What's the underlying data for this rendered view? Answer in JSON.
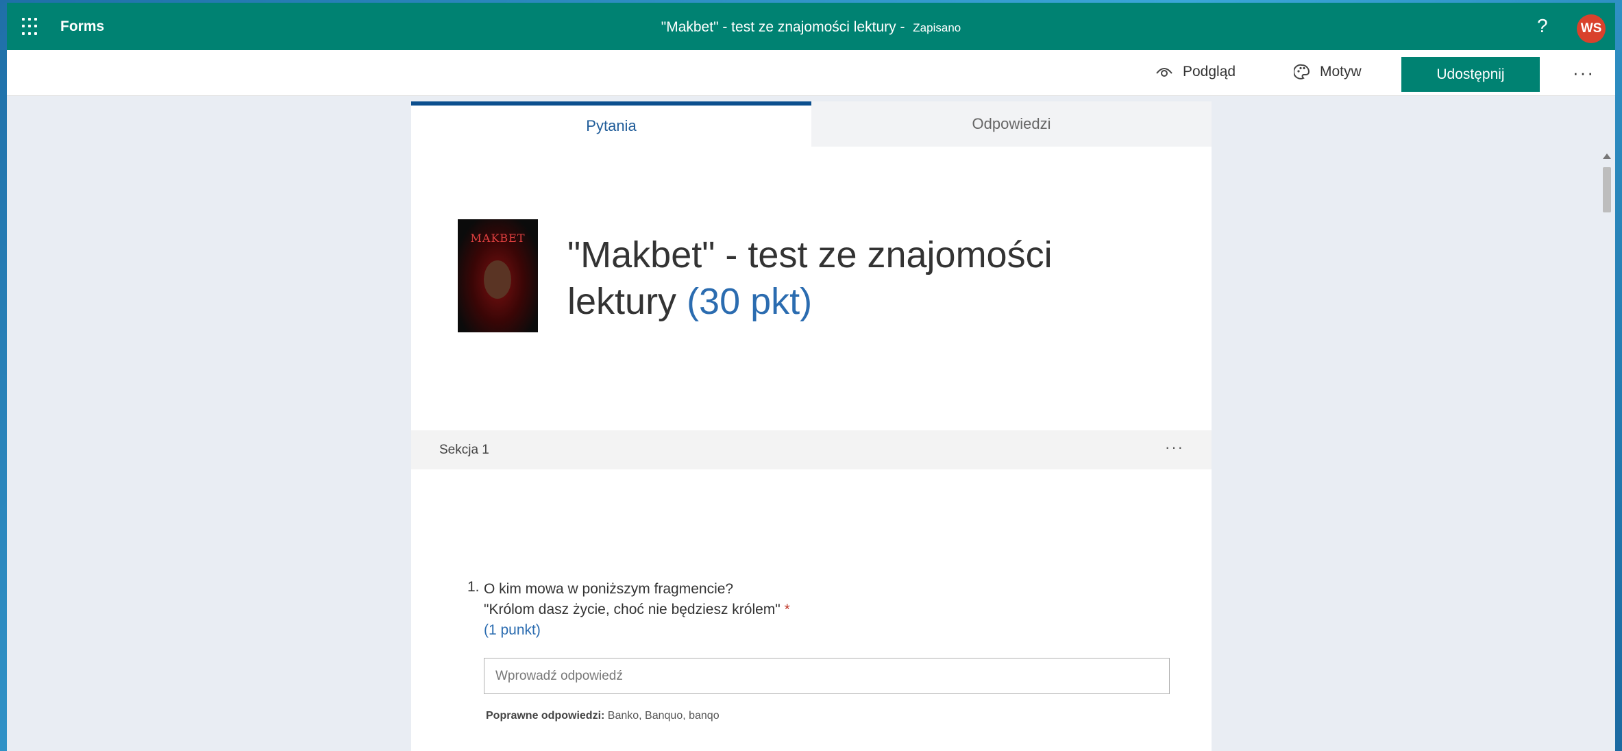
{
  "topbar": {
    "brand": "Forms",
    "doc_title": "\"Makbet\" - test ze znajomości lektury",
    "separator": " - ",
    "saved_status": "Zapisano",
    "help": "?",
    "avatar_initials": "WS"
  },
  "toolbar": {
    "preview_label": "Podgląd",
    "theme_label": "Motyw",
    "share_label": "Udostępnij",
    "more": "···"
  },
  "tabs": [
    {
      "label": "Pytania",
      "active": true
    },
    {
      "label": "Odpowiedzi",
      "active": false
    }
  ],
  "form": {
    "poster_title": "MAKBET",
    "title": "\"Makbet\" - test ze znajomości lektury",
    "points": "(30 pkt)"
  },
  "section": {
    "label": "Sekcja 1",
    "more": "···"
  },
  "question": {
    "number": "1.",
    "line1": "O kim mowa w poniższym fragmencie?",
    "line2": "\"Królom dasz życie, choć nie będziesz królem\"",
    "required": "*",
    "points": "(1 punkt)",
    "placeholder": "Wprowadź odpowiedź",
    "correct_label": "Poprawne odpowiedzi:",
    "correct_values": "Banko, Banquo, banqo"
  },
  "colors": {
    "brand": "#008272",
    "accent": "#0c4f8e",
    "avatar": "#d9412c",
    "required": "#c0392b"
  }
}
